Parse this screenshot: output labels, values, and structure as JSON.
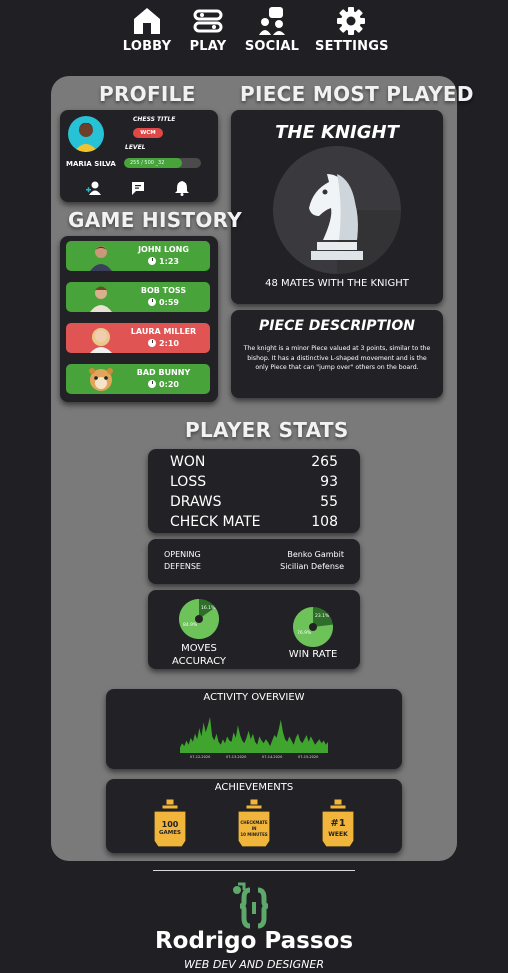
{
  "nav": {
    "items": [
      {
        "label": "LOBBY",
        "icon": "home-icon"
      },
      {
        "label": "PLAY",
        "icon": "gamepad-icon"
      },
      {
        "label": "SOCIAL",
        "icon": "social-icon"
      },
      {
        "label": "SETTINGS",
        "icon": "gear-icon"
      }
    ]
  },
  "profile": {
    "heading": "PROFILE",
    "chess_title_label": "CHESS TITLE",
    "chess_title": "WCM",
    "level_label": "LEVEL",
    "name": "MARIA SILVA",
    "xp_text": "255 / 500 _32",
    "xp_fraction": 0.75
  },
  "piece": {
    "heading": "PIECE MOST PLAYED",
    "name": "THE KNIGHT",
    "mates": "48 MATES WITH THE KNIGHT",
    "description_heading": "PIECE DESCRIPTION",
    "description": "The knight is a minor Piece valued at 3 points, similar to the bishop. It has a distinctive L-shaped movement and is the only Piece that can \"jump over\" others on the board."
  },
  "history": {
    "heading": "GAME HISTORY",
    "games": [
      {
        "name": "JOHN LONG",
        "time": "1:23",
        "result": "win"
      },
      {
        "name": "BOB TOSS",
        "time": "0:59",
        "result": "win"
      },
      {
        "name": "LAURA MILLER",
        "time": "2:10",
        "result": "loss"
      },
      {
        "name": "BAD BUNNY",
        "time": "0:20",
        "result": "win"
      }
    ]
  },
  "stats": {
    "heading": "PLAYER STATS",
    "rows": [
      {
        "label": "WON",
        "value": "265"
      },
      {
        "label": "LOSS",
        "value": "93"
      },
      {
        "label": "DRAWS",
        "value": "55"
      },
      {
        "label": "CHECK MATE",
        "value": "108"
      }
    ],
    "opening_label": "OPENING",
    "opening_value": "Benko Gambit",
    "defense_label": "DEFENSE",
    "defense_value": "Sicilian Defense",
    "moves_accuracy": {
      "label_line1": "MOVES",
      "label_line2": "ACCURACY",
      "main": "84.9%",
      "rest": "16.1%",
      "fraction": 0.849
    },
    "win_rate": {
      "label": "WIN RATE",
      "main": "76.9%",
      "rest": "23.1%",
      "fraction": 0.769
    }
  },
  "activity": {
    "heading": "ACTIVITY OVERVIEW",
    "tick_labels": [
      "07-12-2020",
      "07-13-2020",
      "07-14-2020",
      "07-15-2020"
    ]
  },
  "chart_data": {
    "type": "area",
    "title": "ACTIVITY OVERVIEW",
    "xlabel": "",
    "ylabel": "",
    "categories": [
      "07-12-2020",
      "07-13-2020",
      "07-14-2020",
      "07-15-2020"
    ],
    "values": [
      4,
      7,
      5,
      9,
      6,
      11,
      8,
      14,
      10,
      18,
      12,
      22,
      15,
      20,
      26,
      12,
      9,
      14,
      8,
      6,
      10,
      7,
      12,
      9,
      8,
      15,
      11,
      20,
      13,
      9,
      7,
      11,
      16,
      10,
      14,
      8,
      6,
      12,
      9,
      7,
      10,
      8,
      5,
      9,
      13,
      11,
      17,
      24,
      15,
      10,
      8,
      12,
      9,
      6,
      11,
      14,
      9,
      7,
      10,
      13,
      8,
      12,
      9,
      6,
      8,
      10,
      7,
      9,
      6,
      8
    ]
  },
  "achievements": {
    "heading": "ACHIEVEMENTS",
    "items": [
      {
        "line1": "100",
        "line2": "GAMES"
      },
      {
        "line1": "CHECKMATE",
        "line2": "IN",
        "line3": "10 MINUTES"
      },
      {
        "line1": "#1",
        "line2": "WEEK"
      }
    ]
  },
  "footer": {
    "name": "Rodrigo Passos",
    "subtitle": "WEB DEV AND DESIGNER"
  },
  "colors": {
    "win": "#47a33a",
    "loss": "#e05454",
    "panel": "#7a7a7a",
    "card": "#222226",
    "gold": "#f0b53a",
    "logo": "#5fa86b"
  }
}
